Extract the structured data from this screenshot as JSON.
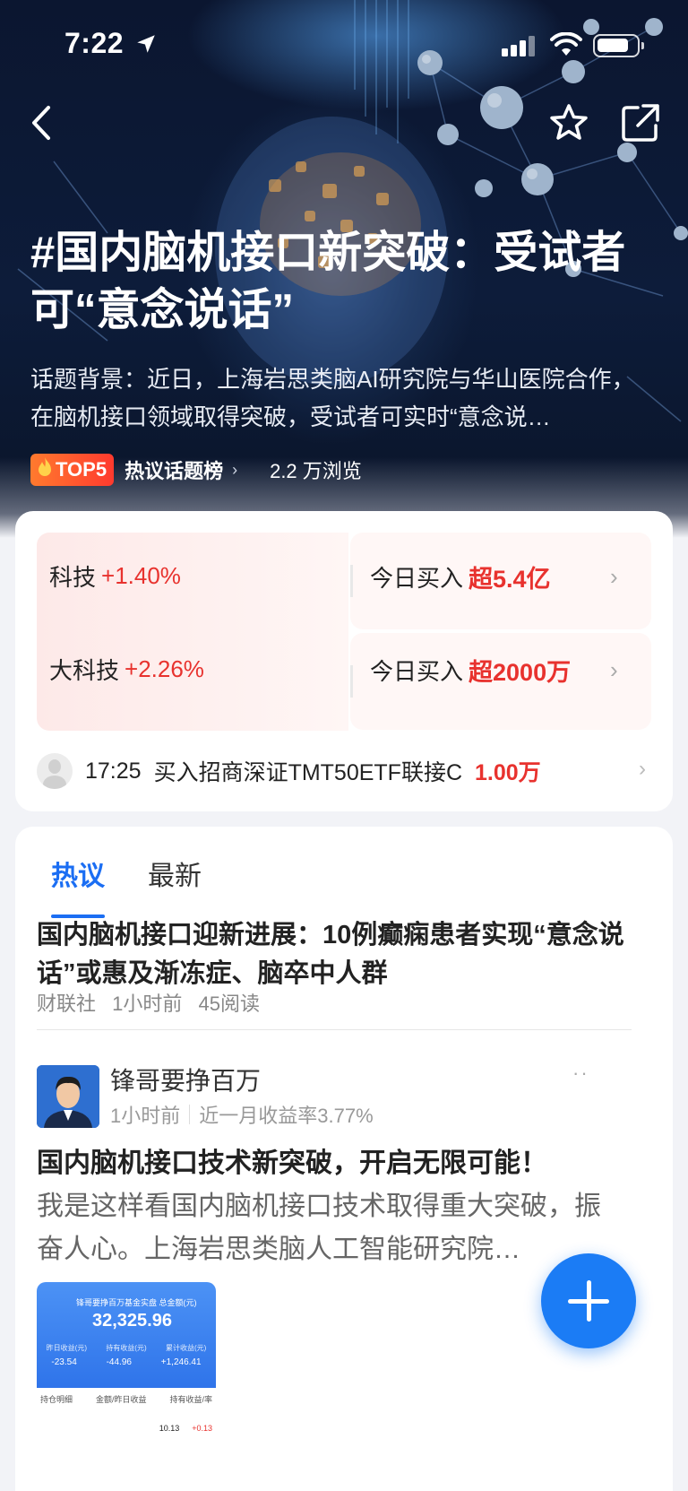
{
  "status_bar": {
    "time": "7:22"
  },
  "nav": {
    "back_icon": "chevron-left-icon",
    "favorite_icon": "star-icon",
    "share_icon": "share-icon"
  },
  "topic": {
    "title": "#国内脑机接口新突破：受试者可“意念说话”",
    "description": "话题背景：近日，上海岩思类脑AI研究院与华山医院合作，在脑机接口领域取得突破，受试者可实时“意念说…",
    "badge": "TOP5",
    "rank_link": "热议话题榜",
    "views": "2.2 万浏览"
  },
  "sectors": [
    {
      "name": "科技",
      "change": "+1.40%",
      "buy_label": "今日买入",
      "buy_amount": "超5.4亿"
    },
    {
      "name": "大科技",
      "change": "+2.26%",
      "buy_label": "今日买入",
      "buy_amount": "超2000万"
    }
  ],
  "trade": {
    "time": "17:25",
    "text": "买入招商深证TMT50ETF联接C",
    "amount": "1.00万"
  },
  "tabs": [
    {
      "label": "热议",
      "active": true
    },
    {
      "label": "最新",
      "active": false
    }
  ],
  "news": {
    "title": "国内脑机接口迎新进展：10例癫痫患者实现“意念说话”或惠及渐冻症、脑卒中人群",
    "source": "财联社",
    "time": "1小时前",
    "reads": "45阅读"
  },
  "post": {
    "author": "锋哥要挣百万",
    "time": "1小时前",
    "return_info": "近一月收益率3.77%",
    "title": "国内脑机接口技术新突破，开启无限可能！",
    "body": "我是这样看国内脑机接口技术取得重大突破，振奋人心。上海岩思类脑人工智能研究院…",
    "more_label": "··",
    "thumbnail": {
      "caption": "锋哥要挣百万基金实盘 总金额(元)",
      "total": "32,325.96",
      "labels": [
        "昨日收益(元)",
        "持有收益(元)",
        "累计收益(元)"
      ],
      "values": [
        "-23.54",
        "-44.96",
        "+1,246.41"
      ],
      "header_left": "持仓明细",
      "header_mid": "金额/昨日收益",
      "header_right": "持有收益/率",
      "row": [
        "10.13",
        "+0.13"
      ]
    }
  },
  "fab": {
    "icon": "plus-icon"
  },
  "colors": {
    "accent": "#1b6ef3",
    "up": "#e8322e",
    "fab": "#1b7cf5"
  }
}
